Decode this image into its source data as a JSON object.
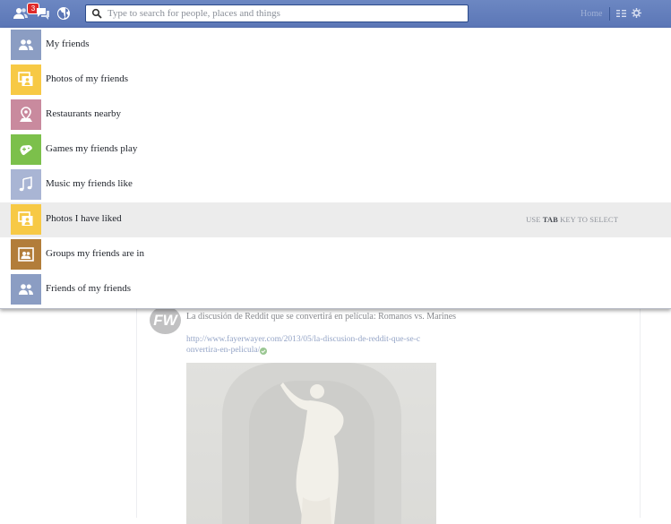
{
  "topbar": {
    "notification_count": "3",
    "search_placeholder": "Type to search for people, places and things",
    "home_label": "Home"
  },
  "dropdown": {
    "items": [
      {
        "label": "My friends",
        "icon": "friends-icon",
        "color": "#8b9dc3"
      },
      {
        "label": "Photos of my friends",
        "icon": "photos-icon",
        "color": "#f7c945"
      },
      {
        "label": "Restaurants nearby",
        "icon": "location-pin-icon",
        "color": "#c98a9e"
      },
      {
        "label": "Games my friends play",
        "icon": "game-controller-icon",
        "color": "#7cc04b"
      },
      {
        "label": "Music my friends like",
        "icon": "music-note-icon",
        "color": "#a9b5d4"
      },
      {
        "label": "Photos I have liked",
        "icon": "photos-icon",
        "color": "#f7c945"
      },
      {
        "label": "Groups my friends are in",
        "icon": "groups-icon",
        "color": "#b27d3a"
      },
      {
        "label": "Friends of my friends",
        "icon": "friends-icon",
        "color": "#8b9dc3"
      }
    ],
    "hint": {
      "prefix": "USE ",
      "key": "TAB",
      "suffix": " KEY TO SELECT"
    }
  },
  "feed": {
    "avatar_text": "FW",
    "post_text": "La discusión de Reddit que se convertirá en película: Romanos vs. Marines",
    "link_line1": "http://www.fayerwayer.com/2013/05/la-discusion-de-reddit-que-se-c",
    "link_line2": "onvertira-en-pelicula/"
  }
}
